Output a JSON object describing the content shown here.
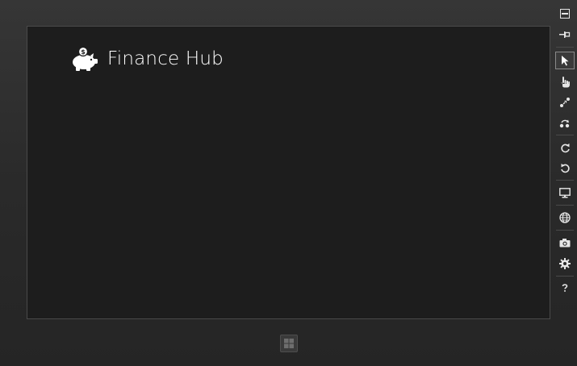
{
  "app": {
    "title": "Finance Hub",
    "logo_icon": "piggy-bank-icon"
  },
  "simulator_toolbar": {
    "buttons": [
      {
        "id": "minimize",
        "icon": "minimize-icon"
      },
      {
        "id": "always-on-top",
        "icon": "pin-icon"
      },
      {
        "id": "mouse-mode",
        "icon": "cursor-icon",
        "selected": true
      },
      {
        "id": "touch-mode",
        "icon": "hand-icon"
      },
      {
        "id": "pinch-zoom",
        "icon": "pinch-icon"
      },
      {
        "id": "rotation-touch",
        "icon": "rotate-touch-icon"
      },
      {
        "id": "rotate-clockwise",
        "icon": "rotate-cw-icon"
      },
      {
        "id": "rotate-counterclockwise",
        "icon": "rotate-ccw-icon"
      },
      {
        "id": "change-resolution",
        "icon": "monitor-icon"
      },
      {
        "id": "set-location",
        "icon": "globe-icon"
      },
      {
        "id": "copy-screenshot",
        "icon": "camera-icon"
      },
      {
        "id": "screenshot-settings",
        "icon": "gear-icon"
      },
      {
        "id": "help",
        "icon": "help-icon"
      }
    ]
  },
  "device": {
    "home_icon": "windows-logo-icon"
  },
  "colors": {
    "screen_bg": "#1d1d1d",
    "bezel": "#2e2e2e",
    "text": "#ffffff",
    "icon": "#e6e6e6"
  }
}
